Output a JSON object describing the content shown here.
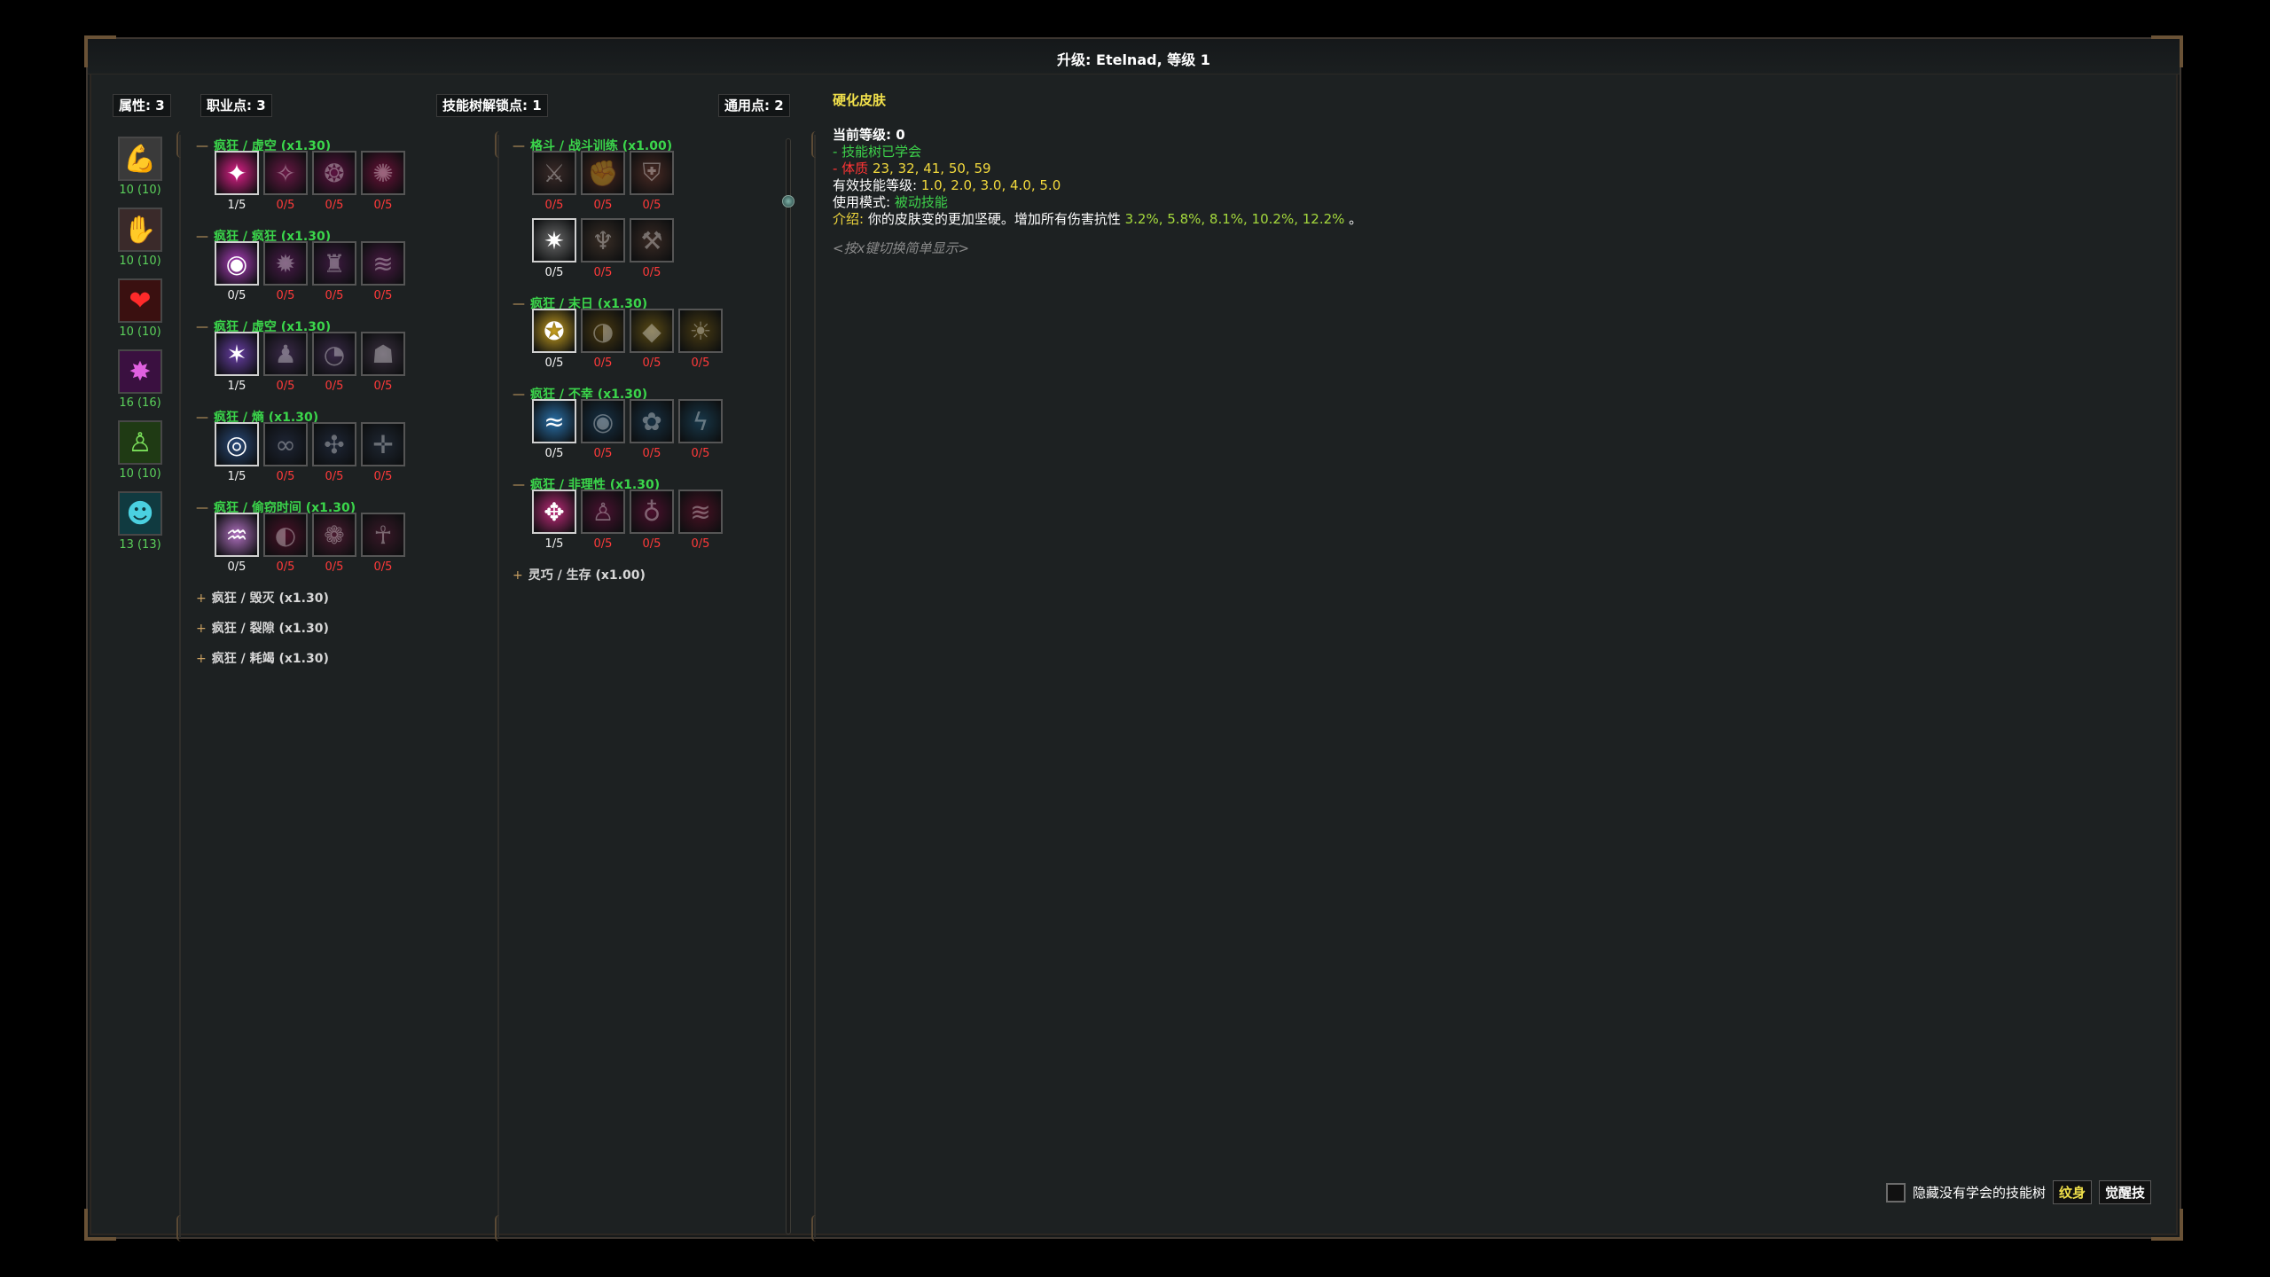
{
  "window": {
    "title": "升级: Etelnad, 等级 1"
  },
  "points": {
    "attribute": "属性: 3",
    "class": "职业点: 3",
    "tree_unlock": "技能树解锁点: 1",
    "generic": "通用点: 2"
  },
  "stats": [
    {
      "icon": "strength-muscle-icon",
      "value": "10 (10)"
    },
    {
      "icon": "dexterity-hand-icon",
      "value": "10 (10)"
    },
    {
      "icon": "constitution-heart-icon",
      "value": "10 (10)"
    },
    {
      "icon": "magic-burst-icon",
      "value": "16 (16)"
    },
    {
      "icon": "willpower-figure-icon",
      "value": "10 (10)"
    },
    {
      "icon": "cunning-hooded-icon",
      "value": "13 (13)"
    }
  ],
  "left_trees": [
    {
      "title": "疯狂 / 虚空 (x1.30)",
      "open": true,
      "skills": [
        {
          "lvl": "1/5",
          "learned": true,
          "color": "#e0208a",
          "glyph": "✦"
        },
        {
          "lvl": "0/5",
          "learned": false,
          "color": "#6a1745",
          "glyph": "✧"
        },
        {
          "lvl": "0/5",
          "learned": false,
          "color": "#5c1240",
          "glyph": "❂"
        },
        {
          "lvl": "0/5",
          "learned": false,
          "color": "#6a1038",
          "glyph": "✺"
        }
      ]
    },
    {
      "title": "疯狂 / 疯狂 (x1.30)",
      "open": true,
      "skills": [
        {
          "lvl": "0/5",
          "learned": true,
          "color": "#b040c0",
          "glyph": "◉"
        },
        {
          "lvl": "0/5",
          "learned": false,
          "color": "#4a1a4a",
          "glyph": "✹"
        },
        {
          "lvl": "0/5",
          "learned": false,
          "color": "#3d1a40",
          "glyph": "♜"
        },
        {
          "lvl": "0/5",
          "learned": false,
          "color": "#4a1a44",
          "glyph": "≋"
        }
      ]
    },
    {
      "title": "疯狂 / 虚空 (x1.30)",
      "open": true,
      "skills": [
        {
          "lvl": "1/5",
          "learned": true,
          "color": "#6a3fa8",
          "glyph": "✶"
        },
        {
          "lvl": "0/5",
          "learned": false,
          "color": "#3b2a4a",
          "glyph": "♟"
        },
        {
          "lvl": "0/5",
          "learned": false,
          "color": "#3a2a48",
          "glyph": "◔"
        },
        {
          "lvl": "0/5",
          "learned": false,
          "color": "#3a2f3f",
          "glyph": "☗"
        }
      ]
    },
    {
      "title": "疯狂 / 熵 (x1.30)",
      "open": true,
      "skills": [
        {
          "lvl": "1/5",
          "learned": true,
          "color": "#2a4a7a",
          "glyph": "◎"
        },
        {
          "lvl": "0/5",
          "learned": false,
          "color": "#1e2535",
          "glyph": "∞"
        },
        {
          "lvl": "0/5",
          "learned": false,
          "color": "#1e2636",
          "glyph": "✣"
        },
        {
          "lvl": "0/5",
          "learned": false,
          "color": "#1f2733",
          "glyph": "✛"
        }
      ]
    },
    {
      "title": "疯狂 / 偷窃时间 (x1.30)",
      "open": true,
      "skills": [
        {
          "lvl": "0/5",
          "learned": true,
          "color": "#b070c0",
          "glyph": "♒"
        },
        {
          "lvl": "0/5",
          "learned": false,
          "color": "#4a1028",
          "glyph": "◐"
        },
        {
          "lvl": "0/5",
          "learned": false,
          "color": "#4a1a30",
          "glyph": "❁"
        },
        {
          "lvl": "0/5",
          "learned": false,
          "color": "#3a1828",
          "glyph": "☥"
        }
      ]
    },
    {
      "title": "疯狂 / 毁灭 (x1.30)",
      "open": false,
      "skills": []
    },
    {
      "title": "疯狂 / 裂隙 (x1.30)",
      "open": false,
      "skills": []
    },
    {
      "title": "疯狂 / 耗竭 (x1.30)",
      "open": false,
      "skills": []
    }
  ],
  "right_trees": [
    {
      "title": "格斗 / 战斗训练 (x1.00)",
      "open": true,
      "skills": [
        {
          "lvl": "0/5",
          "learned": false,
          "color": "#3a2a28",
          "glyph": "⚔"
        },
        {
          "lvl": "0/5",
          "learned": false,
          "color": "#4a2820",
          "glyph": "✊"
        },
        {
          "lvl": "0/5",
          "learned": false,
          "color": "#4a2a24",
          "glyph": "⛨"
        },
        {
          "lvl": "0/5",
          "learned": true,
          "color": "#6a6a6a",
          "glyph": "✷"
        },
        {
          "lvl": "0/5",
          "learned": false,
          "color": "#3a2e26",
          "glyph": "♆"
        },
        {
          "lvl": "0/5",
          "learned": false,
          "color": "#3a2a24",
          "glyph": "⚒"
        }
      ]
    },
    {
      "title": "疯狂 / 末日 (x1.30)",
      "open": true,
      "skills": [
        {
          "lvl": "0/5",
          "learned": true,
          "color": "#c8a020",
          "glyph": "✪"
        },
        {
          "lvl": "0/5",
          "learned": false,
          "color": "#4a3a10",
          "glyph": "◑"
        },
        {
          "lvl": "0/5",
          "learned": false,
          "color": "#5a4a14",
          "glyph": "◆"
        },
        {
          "lvl": "0/5",
          "learned": false,
          "color": "#4a3c12",
          "glyph": "☀"
        }
      ]
    },
    {
      "title": "疯狂 / 不幸 (x1.30)",
      "open": true,
      "skills": [
        {
          "lvl": "0/5",
          "learned": true,
          "color": "#2a70a8",
          "glyph": "≈"
        },
        {
          "lvl": "0/5",
          "learned": false,
          "color": "#173247",
          "glyph": "◉"
        },
        {
          "lvl": "0/5",
          "learned": false,
          "color": "#173042",
          "glyph": "✿"
        },
        {
          "lvl": "0/5",
          "learned": false,
          "color": "#18384a",
          "glyph": "ϟ"
        }
      ]
    },
    {
      "title": "疯狂 / 非理性 (x1.30)",
      "open": true,
      "skills": [
        {
          "lvl": "1/5",
          "learned": true,
          "color": "#c02a7a",
          "glyph": "✥"
        },
        {
          "lvl": "0/5",
          "learned": false,
          "color": "#4a1030",
          "glyph": "♙"
        },
        {
          "lvl": "0/5",
          "learned": false,
          "color": "#4a0f2c",
          "glyph": "♁"
        },
        {
          "lvl": "0/5",
          "learned": false,
          "color": "#4a1024",
          "glyph": "≋"
        }
      ]
    },
    {
      "title": "灵巧 / 生存 (x1.00)",
      "open": false,
      "skills": []
    }
  ],
  "details": {
    "title": "硬化皮肤",
    "current_level": "当前等级:  0",
    "learned": "- 技能树已学会",
    "req_label": "- 体质",
    "req_values": " 23, 32, 41, 50, 59",
    "eff_label": "有效技能等级: ",
    "eff_values": "1.0, 2.0, 3.0, 4.0, 5.0",
    "mode_label": "使用模式: ",
    "mode_value": "被动技能",
    "desc_label": "介绍: ",
    "desc_text": "你的皮肤变的更加坚硬。增加所有伤害抗性 ",
    "desc_values": "3.2%, 5.8%, 8.1%, 10.2%, 12.2%",
    "desc_end": " 。",
    "hint": "<按x键切换简单显示>"
  },
  "bottom": {
    "hide_label": "隐藏没有学会的技能树",
    "tattoo_label": "纹身",
    "awaken_label": "觉醒技"
  }
}
